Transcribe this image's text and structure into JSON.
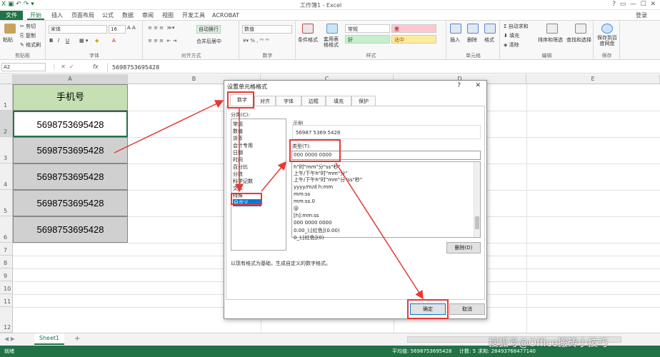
{
  "title_bar": {
    "title": "工作簿1 - Excel"
  },
  "tabs": [
    "文件",
    "开始",
    "插入",
    "页面布局",
    "公式",
    "数据",
    "审阅",
    "视图",
    "开发工具",
    "ACROBAT"
  ],
  "login": "登录",
  "ribbon": {
    "clipboard": {
      "paste": "粘贴",
      "cut": "剪切",
      "copy": "复制",
      "format_painter": "格式刷",
      "label": "剪贴板"
    },
    "font": {
      "name": "宋体",
      "size": "16",
      "label": "字体"
    },
    "alignment": {
      "wrap": "自动换行",
      "merge": "合并后居中",
      "label": "对齐方式"
    },
    "number": {
      "format": "数值",
      "label": "数字"
    },
    "styles": {
      "conditional": "条件格式",
      "table": "套用表格格式",
      "normal": "常规",
      "bad": "差",
      "good": "好",
      "neutral": "适中",
      "label": "样式"
    },
    "cells": {
      "insert": "插入",
      "delete": "删除",
      "format": "格式",
      "label": "单元格"
    },
    "editing": {
      "autosum": "自动求和",
      "fill": "填充",
      "clear": "清除",
      "sort": "排序和筛选",
      "find": "查找和选择",
      "label": "编辑"
    },
    "save": {
      "save_to": "保存到百度网盘",
      "label": "保存"
    }
  },
  "formula_bar": {
    "name_box": "A2",
    "fx": "fx",
    "value": "5698753695428"
  },
  "columns": [
    "A",
    "B",
    "C",
    "D",
    "E"
  ],
  "rows": [
    "1",
    "2",
    "3",
    "4",
    "5",
    "6",
    "7",
    "8",
    "9",
    "10",
    "11",
    "12"
  ],
  "cells": {
    "header": "手机号",
    "values": [
      "5698753695428",
      "5698753695428",
      "5698753695428",
      "5698753695428",
      "5698753695428"
    ]
  },
  "dialog": {
    "title": "设置单元格格式",
    "help": "?",
    "close": "✕",
    "tabs": [
      "数字",
      "对齐",
      "字体",
      "边框",
      "填充",
      "保护"
    ],
    "category_label": "分类(C):",
    "categories": [
      "常规",
      "数值",
      "货币",
      "会计专用",
      "日期",
      "时间",
      "百分比",
      "分数",
      "科学记数",
      "文本",
      "特殊",
      "自定义"
    ],
    "sample_label": "示例",
    "sample_value": "56987 5369 5428",
    "type_label": "类型(T):",
    "type_value": "000 0000 0000",
    "formats": [
      "h\"时\"mm\"分\"ss\"秒\"",
      "上午/下午h\"时\"mm\"分\"",
      "上午/下午h\"时\"mm\"分\"ss\"秒\"",
      "yyyy/m/d h:mm",
      "mm:ss",
      "mm:ss.0",
      "@",
      "[h]:mm:ss",
      "000 0000 0000",
      "0.00_);[红色](0.00)",
      "0_);[红色](0)"
    ],
    "delete": "删除(D)",
    "description": "以现有格式为基础，生成自定义的数字格式。",
    "ok": "确定",
    "cancel": "取消"
  },
  "sheet_tab": "Sheet1",
  "add_sheet": "+",
  "status": {
    "ready": "就绪",
    "average": "平均值: 5698753695428",
    "count": "计数: 5",
    "sum": "求和: 28493768477140"
  },
  "watermark": "搜狐号@Office搬砖小技巧"
}
